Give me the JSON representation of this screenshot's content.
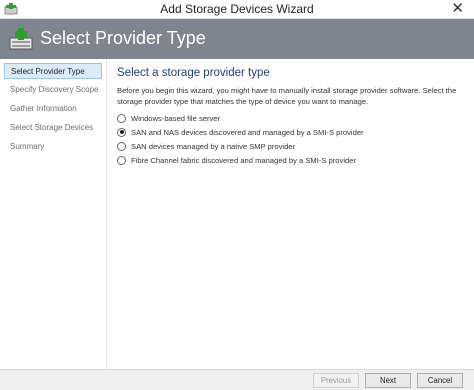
{
  "window": {
    "title": "Add Storage Devices Wizard",
    "close_glyph": "✕"
  },
  "header": {
    "title": "Select Provider Type",
    "icon": "storage-add-icon"
  },
  "sidebar": {
    "items": [
      {
        "label": "Select Provider Type",
        "active": true
      },
      {
        "label": "Specify Discovery Scope",
        "active": false
      },
      {
        "label": "Gather Information",
        "active": false
      },
      {
        "label": "Select Storage Devices",
        "active": false
      },
      {
        "label": "Summary",
        "active": false
      }
    ]
  },
  "main": {
    "heading": "Select a storage provider type",
    "description": "Before you begin this wizard, you might have to manually install storage provider software. Select the storage provider type that matches the type of device you want to manage.",
    "options": [
      {
        "label": "Windows-based file server",
        "selected": false
      },
      {
        "label": "SAN and NAS devices discovered and managed by a SMI-S provider",
        "selected": true
      },
      {
        "label": "SAN devices managed by a native SMP provider",
        "selected": false
      },
      {
        "label": "Fibre Channel fabric discovered and managed by a SMI-S provider",
        "selected": false
      }
    ]
  },
  "footer": {
    "previous_label": "Previous",
    "next_label": "Next",
    "cancel_label": "Cancel"
  },
  "colors": {
    "header_bg": "#7d8591",
    "active_item_bg": "#dcebf8",
    "heading_text": "#1f3f73"
  }
}
